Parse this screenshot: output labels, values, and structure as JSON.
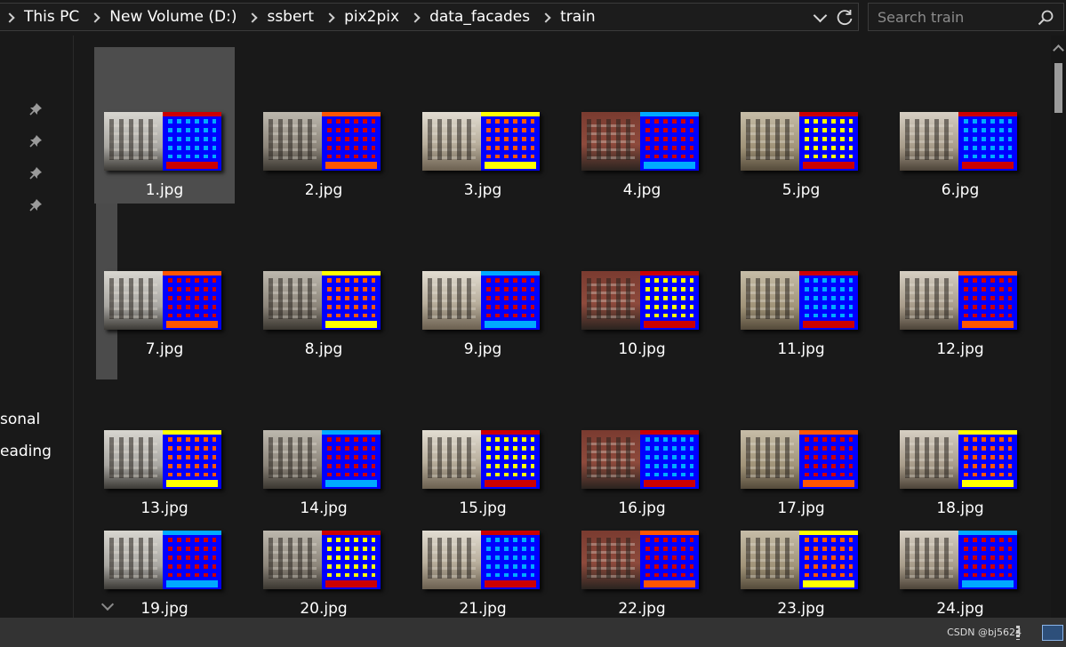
{
  "address_bar": {
    "breadcrumbs": [
      "This PC",
      "New Volume (D:)",
      "ssbert",
      "pix2pix",
      "data_facades",
      "train"
    ]
  },
  "search": {
    "placeholder": "Search train"
  },
  "nav_pane": {
    "visible_items": [
      "sonal",
      "eading"
    ]
  },
  "files": [
    {
      "name": "1.jpg",
      "selected": true
    },
    {
      "name": "2.jpg"
    },
    {
      "name": "3.jpg"
    },
    {
      "name": "4.jpg"
    },
    {
      "name": "5.jpg"
    },
    {
      "name": "6.jpg"
    },
    {
      "name": "7.jpg"
    },
    {
      "name": "8.jpg"
    },
    {
      "name": "9.jpg"
    },
    {
      "name": "10.jpg"
    },
    {
      "name": "11.jpg"
    },
    {
      "name": "12.jpg"
    },
    {
      "name": "13.jpg"
    },
    {
      "name": "14.jpg"
    },
    {
      "name": "15.jpg"
    },
    {
      "name": "16.jpg"
    },
    {
      "name": "17.jpg"
    },
    {
      "name": "18.jpg"
    },
    {
      "name": "19.jpg"
    },
    {
      "name": "20.jpg"
    },
    {
      "name": "21.jpg"
    },
    {
      "name": "22.jpg"
    },
    {
      "name": "23.jpg"
    },
    {
      "name": "24.jpg"
    }
  ],
  "status_bar": {
    "watermark": "CSDN @bj5624"
  },
  "colors": {
    "background": "#191919",
    "selection": "#4d4d4d",
    "label_blue": "#0000ff",
    "label_red": "#cc0000",
    "label_orange": "#ff5500",
    "label_yellow": "#ffff00",
    "label_cyan": "#00aaff"
  }
}
